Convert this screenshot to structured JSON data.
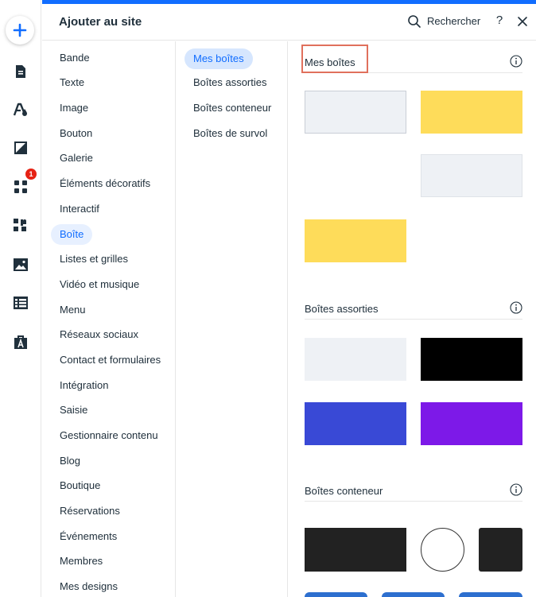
{
  "header": {
    "title": "Ajouter au site",
    "search_label": "Rechercher",
    "help_label": "?"
  },
  "rail": {
    "notification_count": "1"
  },
  "categories": [
    "Bande",
    "Texte",
    "Image",
    "Bouton",
    "Galerie",
    "Éléments décoratifs",
    "Interactif",
    "Boîte",
    "Listes et grilles",
    "Vidéo et musique",
    "Menu",
    "Réseaux sociaux",
    "Contact et formulaires",
    "Intégration",
    "Saisie",
    "Gestionnaire contenu",
    "Blog",
    "Boutique",
    "Réservations",
    "Événements",
    "Membres",
    "Mes designs"
  ],
  "active_category": "Boîte",
  "subcategories": [
    "Mes boîtes",
    "Boîtes assorties",
    "Boîtes conteneur",
    "Boîtes de survol"
  ],
  "active_subcategory": "Mes boîtes",
  "sections": {
    "mes_boites": {
      "title": "Mes boîtes"
    },
    "boites_assorties": {
      "title": "Boîtes assorties"
    },
    "boites_conteneur": {
      "title": "Boîtes conteneur"
    }
  },
  "colors": {
    "accent": "#116dff",
    "light_gray": "#eef1f5",
    "yellow": "#fedc5a",
    "black": "#000000",
    "dark": "#222222",
    "royal_blue": "#3949d6",
    "purple": "#7d19e8",
    "highlight": "#e0705c",
    "badge": "#e62214"
  }
}
